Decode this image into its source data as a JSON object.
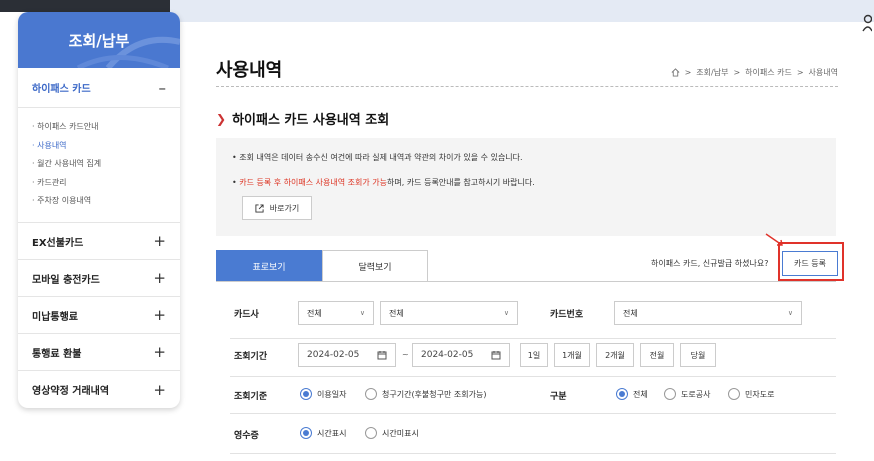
{
  "sidebar": {
    "title": "조회/납부",
    "active_item": "하이패스 카드",
    "active_toggle": "–",
    "sub_items": [
      "하이패스 카드안내",
      "사용내역",
      "월간 사용내역 집계",
      "카드관리",
      "주차장 이용내역"
    ],
    "items": [
      {
        "label": "EX선불카드",
        "toggle": "+"
      },
      {
        "label": "모바일 충전카드",
        "toggle": "+"
      },
      {
        "label": "미납통행료",
        "toggle": "+"
      },
      {
        "label": "통행료 환불",
        "toggle": "+"
      },
      {
        "label": "영상약정 거래내역",
        "toggle": "+"
      }
    ]
  },
  "header": {
    "page_title": "사용내역",
    "breadcrumb": [
      "조회/납부",
      "하이패스 카드",
      "사용내역"
    ]
  },
  "section": {
    "title": "하이패스 카드 사용내역 조회",
    "notice1": "조회 내역은 데이터 송수신 여건에 따라 실제 내역과 약관의 차이가 있을 수 있습니다.",
    "notice2_red": "카드 등록 후 하이패스 사용내역 조회가 가능",
    "notice2_rest": "하며, 카드 등록안내를 참고하시기 바랍니다.",
    "goto_label": "바로가기"
  },
  "tabs": {
    "tab1": "표로보기",
    "tab2": "달력보기",
    "register_prompt": "하이패스 카드, 신규발급 하셨나요?",
    "register_button": "카드 등록"
  },
  "form": {
    "card_company_label": "카드사",
    "card_company_select1": "전체",
    "card_company_select2": "전체",
    "card_number_label": "카드번호",
    "card_number_select": "전체",
    "period_label": "조회기간",
    "date_from": "2024-02-05",
    "date_sep": "~",
    "date_to": "2024-02-05",
    "period_buttons": [
      "1일",
      "1개월",
      "2개월",
      "전월",
      "당월"
    ],
    "criteria_label": "조회기준",
    "criteria_opt1": "이용일자",
    "criteria_opt2": "청구기간(후불청구만 조회가능)",
    "type_label": "구분",
    "type_opt1": "전체",
    "type_opt2": "도로공사",
    "type_opt3": "민자도로",
    "receipt_label": "영수증",
    "receipt_opt1": "시간표시",
    "receipt_opt2": "시간미표시"
  },
  "colors": {
    "accent": "#4a7bd2",
    "highlight": "#e0322a"
  }
}
